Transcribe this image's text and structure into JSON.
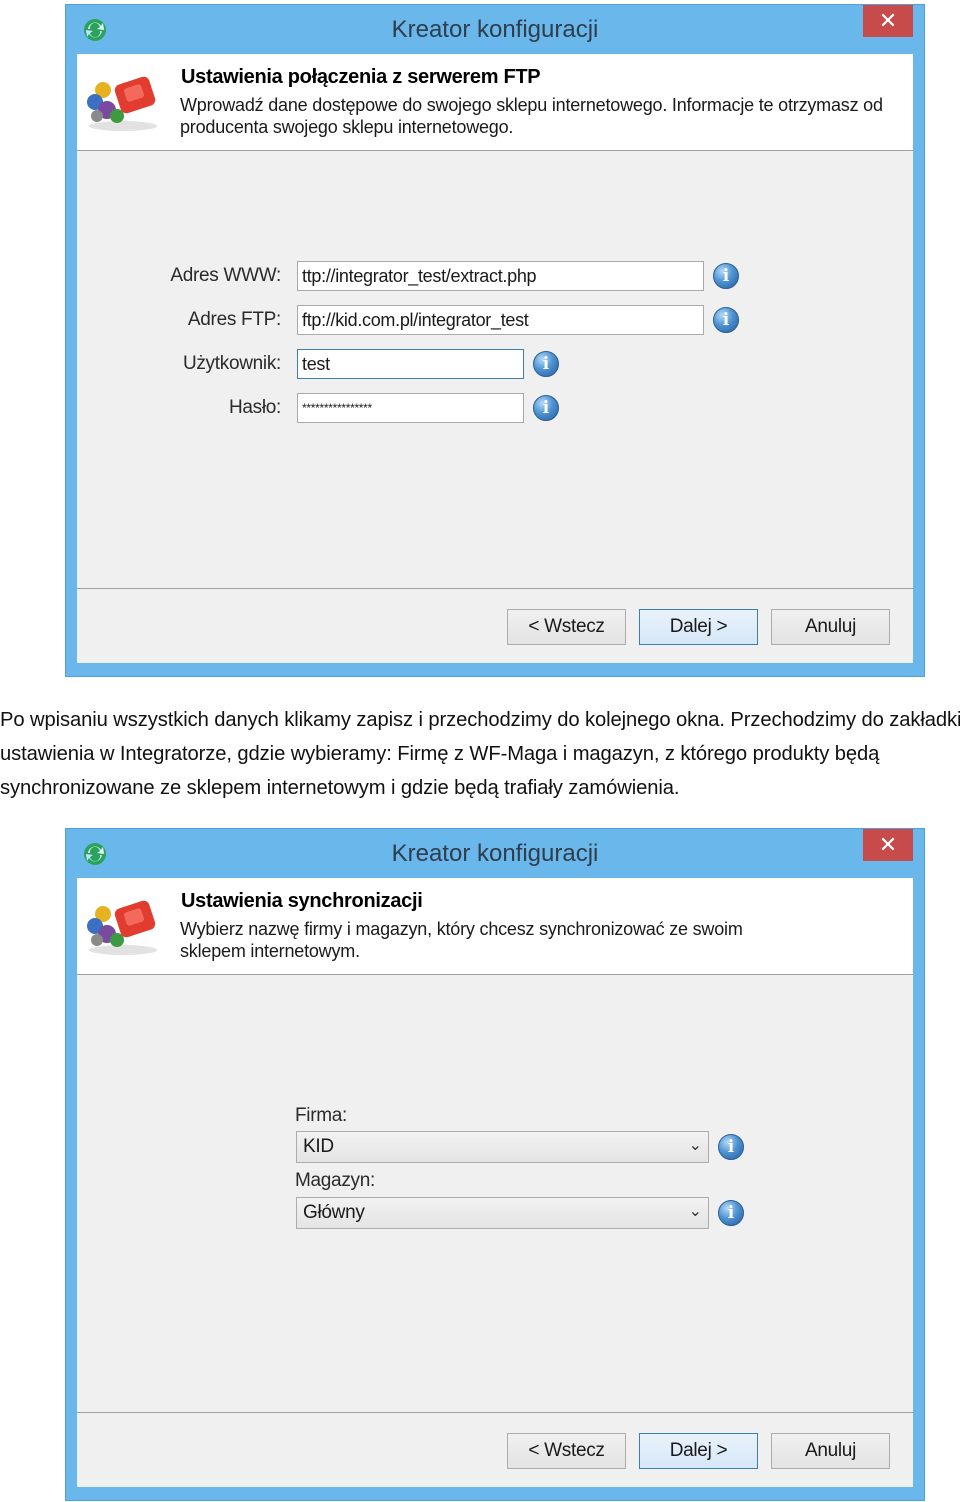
{
  "window1": {
    "title": "Kreator konfiguracji",
    "close_symbol": "✕",
    "header_title": "Ustawienia połączenia z serwerem FTP",
    "header_desc": "Wprowadź dane dostępowe do swojego sklepu internetowego. Informacje te otrzymasz od producenta swojego sklepu internetowego.",
    "fields": {
      "www_label": "Adres WWW:",
      "www_value": "ttp://integrator_test/extract.php",
      "ftp_label": "Adres FTP:",
      "ftp_value": "ftp://kid.com.pl/integrator_test",
      "user_label": "Użytkownik:",
      "user_value": "test",
      "pass_label": "Hasło:",
      "pass_value": "****************"
    },
    "info_symbol": "i",
    "buttons": {
      "back": "< Wstecz",
      "next": "Dalej >",
      "cancel": "Anuluj"
    }
  },
  "paragraph": "Po wpisaniu wszystkich danych klikamy zapisz i przechodzimy do kolejnego okna. Przechodzimy do zakładki ustawienia w Integratorze, gdzie wybieramy: Firmę z WF-Maga i magazyn, z którego produkty będą synchronizowane ze sklepem internetowym i gdzie będą trafiały zamówienia.",
  "window2": {
    "title": "Kreator konfiguracji",
    "close_symbol": "✕",
    "header_title": "Ustawienia synchronizacji",
    "header_desc": "Wybierz nazwę firmy i magazyn, który chcesz synchronizować ze swoim sklepem internetowym.",
    "firma_label": "Firma:",
    "firma_value": "KID",
    "magazyn_label": "Magazyn:",
    "magazyn_value": "Główny",
    "dropdown_symbol": "⌄",
    "info_symbol": "i",
    "buttons": {
      "back": "< Wstecz",
      "next": "Dalej >",
      "cancel": "Anuluj"
    }
  },
  "colors": {
    "titlebar": "#6ab7ec",
    "close": "#c74b4b",
    "dialog_bg": "#f0f0f0",
    "default_button_border": "#3c7fb1"
  },
  "icons": [
    "app-sync-icon",
    "close-icon",
    "wizard-logo-icon",
    "info-icon",
    "chevron-down-icon"
  ]
}
